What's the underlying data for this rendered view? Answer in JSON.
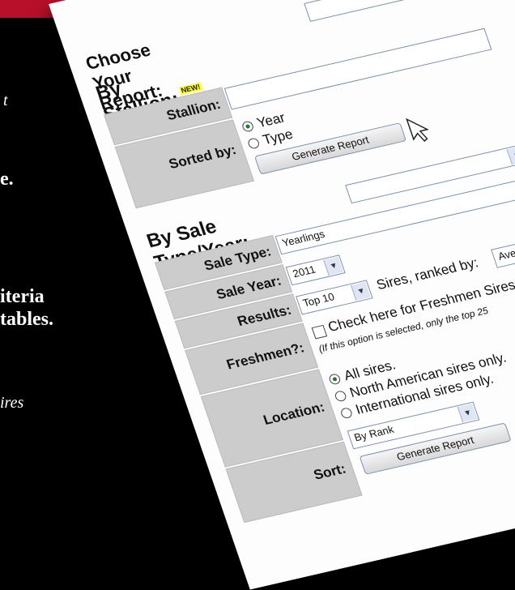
{
  "background_text": [
    "t",
    "e.",
    "iteria",
    "tables.",
    "ires"
  ],
  "form": {
    "choose_title": "Choose Your Report:",
    "by_stallion": {
      "title": "By Stallion:",
      "new_badge": "NEW!",
      "stallion_label": "Stallion:",
      "stallion_value": "",
      "sorted_by_label": "Sorted by:",
      "options": [
        "Year",
        "Type"
      ],
      "selected": "Year",
      "button": "Generate Report"
    },
    "by_sale": {
      "title": "By Sale Type/Year:",
      "sale_type_label": "Sale Type:",
      "sale_type_value": "Yearlings",
      "sale_year_label": "Sale Year:",
      "sale_year_value": "2011",
      "results_label": "Results:",
      "results_value": "Top 10",
      "ranked_by_text": "Sires, ranked by:",
      "ranked_by_value": "Avera",
      "freshmen_label": "Freshmen?:",
      "freshmen_check_text": "Check here for Freshmen Sires",
      "freshmen_note": "(If this option is selected, only the top 25",
      "location_label": "Location:",
      "location_options": [
        "All sires.",
        "North American sires only.",
        "International sires only."
      ],
      "location_selected": "All sires.",
      "sort_label": "Sort:",
      "sort_value": "By Rank",
      "button": "Generate Report"
    }
  }
}
